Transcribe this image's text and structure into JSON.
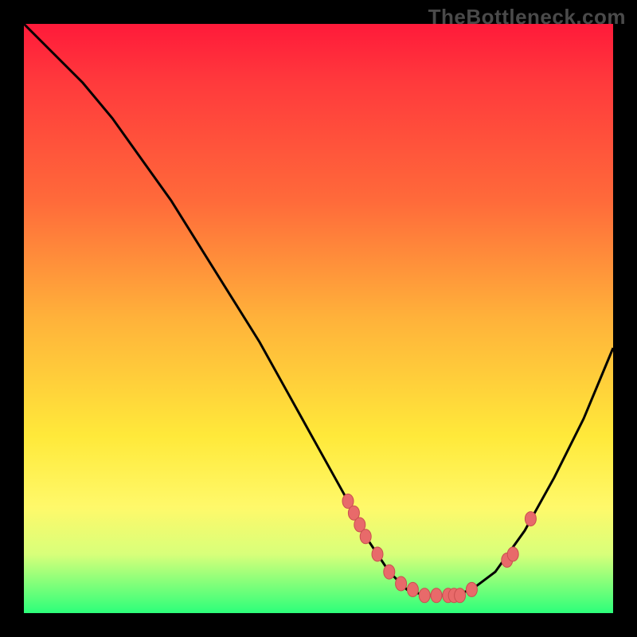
{
  "watermark": "TheBottleneck.com",
  "chart_data": {
    "type": "line",
    "title": "",
    "xlabel": "",
    "ylabel": "",
    "xlim": [
      0,
      100
    ],
    "ylim": [
      0,
      100
    ],
    "curve": {
      "x": [
        0,
        5,
        10,
        15,
        20,
        25,
        30,
        35,
        40,
        45,
        50,
        55,
        58,
        60,
        62,
        65,
        68,
        70,
        73,
        76,
        80,
        85,
        90,
        95,
        100
      ],
      "y": [
        100,
        95,
        90,
        84,
        77,
        70,
        62,
        54,
        46,
        37,
        28,
        19,
        13,
        10,
        7,
        4,
        3,
        3,
        3,
        4,
        7,
        14,
        23,
        33,
        45
      ]
    },
    "markers": {
      "x": [
        55,
        56,
        57,
        58,
        60,
        62,
        64,
        66,
        68,
        70,
        72,
        73,
        74,
        76,
        82,
        83,
        86
      ],
      "y": [
        19,
        17,
        15,
        13,
        10,
        7,
        5,
        4,
        3,
        3,
        3,
        3,
        3,
        4,
        9,
        10,
        16
      ]
    }
  }
}
